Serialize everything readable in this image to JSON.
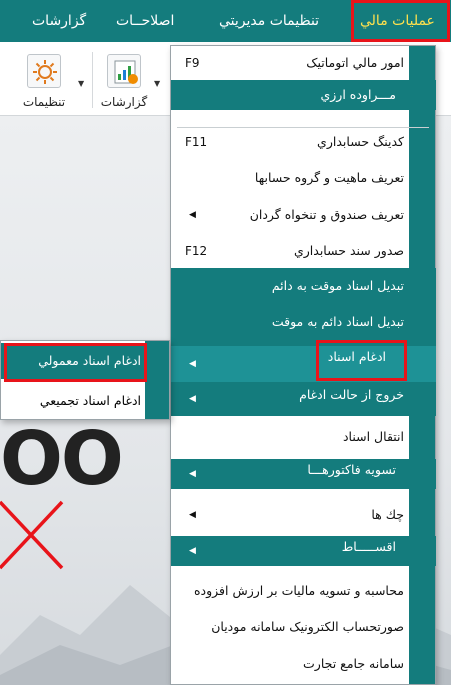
{
  "menubar": {
    "items": [
      {
        "label": "عملیات مالي",
        "active": true
      },
      {
        "label": "تنظیمات مدیریتي",
        "active": false
      },
      {
        "label": "اصلاحــات",
        "active": false
      },
      {
        "label": "گزارشات",
        "active": false
      }
    ]
  },
  "toolbar": {
    "settings_label": "تنظیمات",
    "reports_label": "گزارشات"
  },
  "dropdown": {
    "items": [
      {
        "label": "امور مالي اتوماتیک",
        "key": "F9"
      },
      {
        "label": "مـــراوده ارزي"
      },
      {
        "label": "کدینگ حسابداري",
        "key": "F11"
      },
      {
        "label": "تعریف ماهیت و گروه حسابها"
      },
      {
        "label": "تعریف صندوق و تنخواه گردان"
      },
      {
        "label": "صدور سند حسابداري",
        "key": "F12"
      },
      {
        "label": "تبدیل اسناد موقت به دائم"
      },
      {
        "label": "تبدیل اسناد دائم به موقت"
      },
      {
        "label": "ادغام اسناد"
      },
      {
        "label": "خروج از حالت ادغام"
      },
      {
        "label": "انتقال اسناد"
      },
      {
        "label": "تسویه فاکتورهـــا"
      },
      {
        "label": "چك ها"
      },
      {
        "label": "اقســـــاط"
      },
      {
        "label": "محاسبه و تسویه مالیات بر ارزش افزوده"
      },
      {
        "label": "صورتحساب الکترونیک سامانه مودیان"
      },
      {
        "label": "سامانه جامع تجارت"
      }
    ]
  },
  "submenu": {
    "items": [
      {
        "label": "ادغام اسناد معمولي"
      },
      {
        "label": "ادغام اسناد تجمیعي"
      }
    ]
  },
  "colors": {
    "teal": "#147c7d",
    "highlight": "#1e9296",
    "annotation_red": "#e8141a",
    "active_menu_text": "#ffe14d"
  }
}
